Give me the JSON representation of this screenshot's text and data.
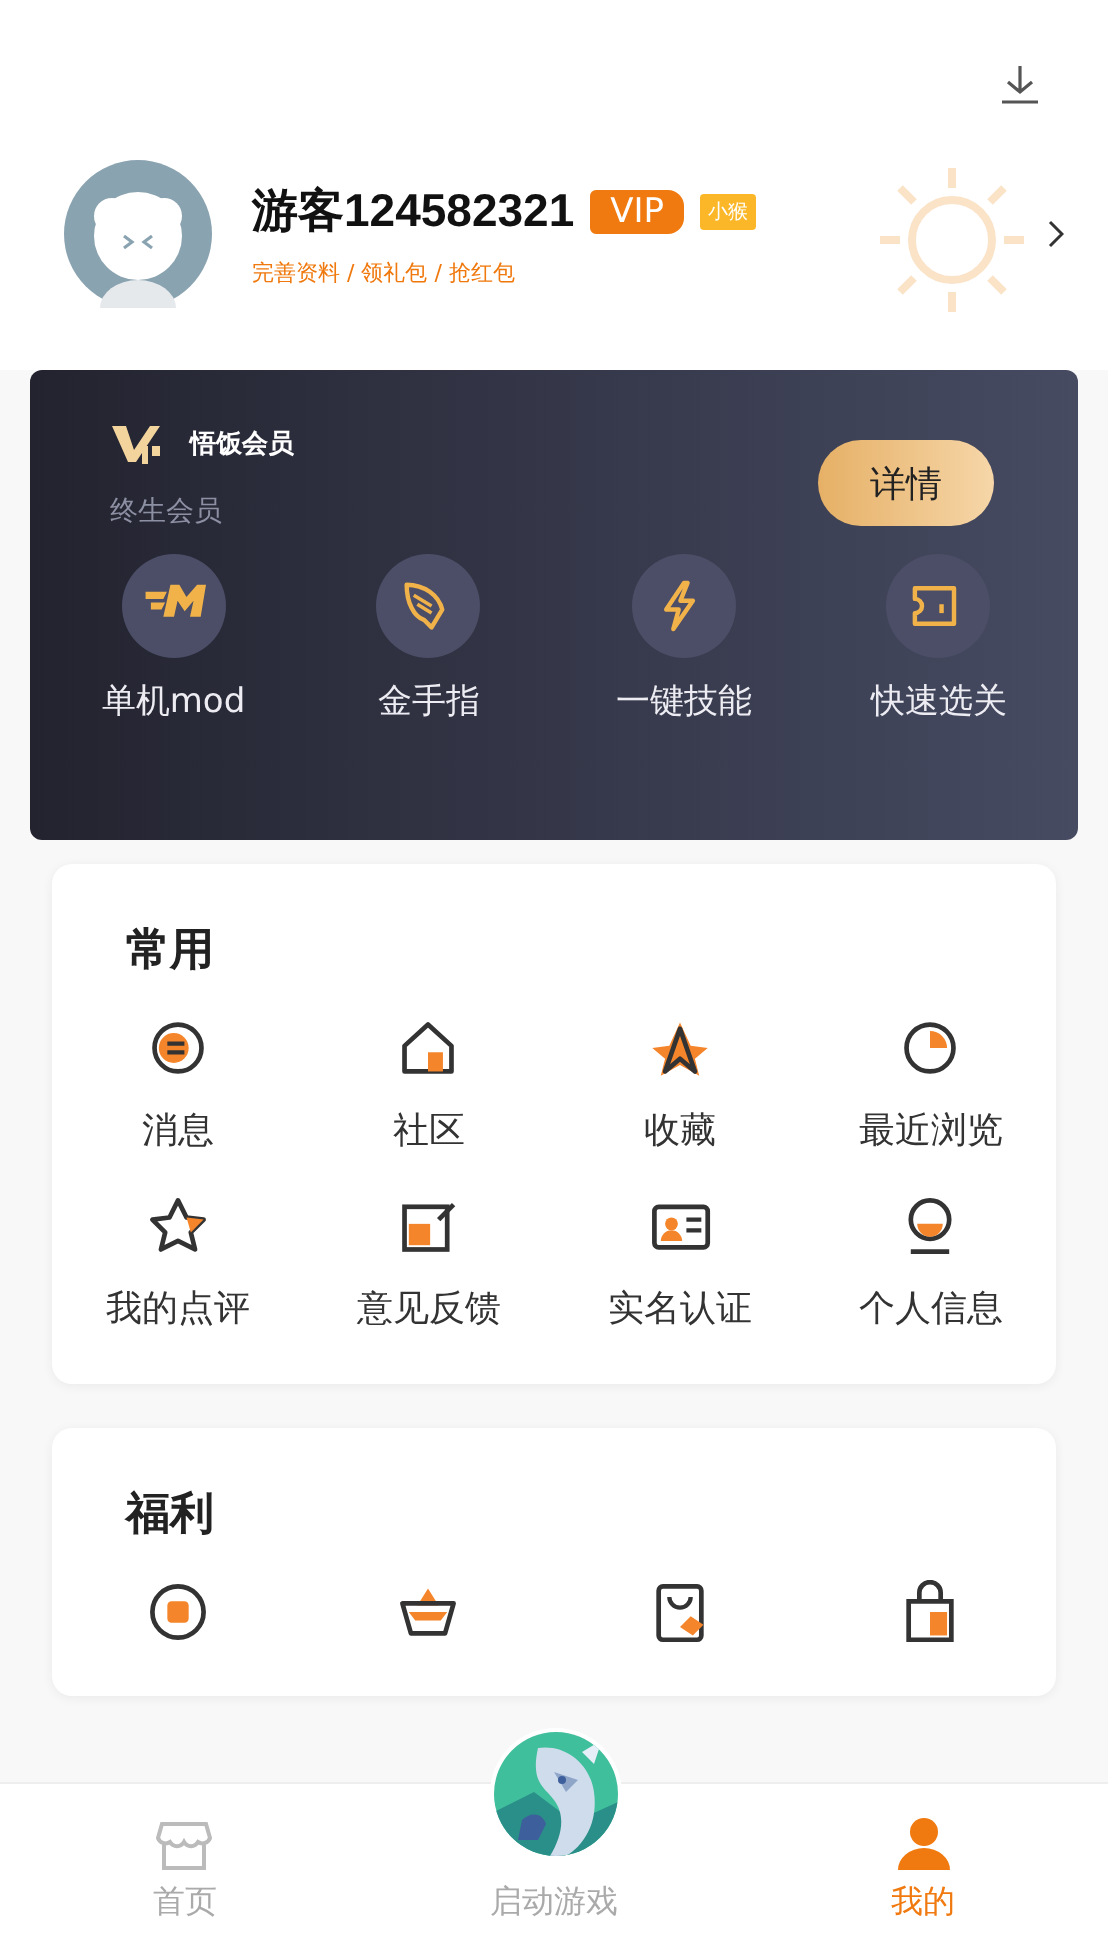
{
  "profile": {
    "name": "游客124582321",
    "vip_badge": "VIP",
    "tag": "小猴",
    "links": "完善资料 / 领礼包 / 抢红包"
  },
  "vip_card": {
    "brand": "悟饭会员",
    "subtitle": "终生会员",
    "detail_button": "详情",
    "features": [
      {
        "label": "单机mod",
        "kind": "mod"
      },
      {
        "label": "金手指",
        "kind": "wing"
      },
      {
        "label": "一键技能",
        "kind": "bolt"
      },
      {
        "label": "快速选关",
        "kind": "ticket"
      }
    ]
  },
  "common": {
    "title": "常用",
    "items": [
      {
        "label": "消息",
        "kind": "message"
      },
      {
        "label": "社区",
        "kind": "house"
      },
      {
        "label": "收藏",
        "kind": "favorite"
      },
      {
        "label": "最近浏览",
        "kind": "recent"
      },
      {
        "label": "我的点评",
        "kind": "review"
      },
      {
        "label": "意见反馈",
        "kind": "feedback"
      },
      {
        "label": "实名认证",
        "kind": "idcard"
      },
      {
        "label": "个人信息",
        "kind": "person"
      }
    ]
  },
  "welfare": {
    "title": "福利",
    "items": [
      {
        "kind": "coin"
      },
      {
        "kind": "basket"
      },
      {
        "kind": "card"
      },
      {
        "kind": "bag"
      }
    ]
  },
  "bottom_nav": [
    {
      "label": "首页",
      "kind": "home",
      "selected": false
    },
    {
      "label": "启动游戏",
      "kind": "game",
      "selected": false
    },
    {
      "label": "我的",
      "kind": "me",
      "selected": true
    }
  ]
}
